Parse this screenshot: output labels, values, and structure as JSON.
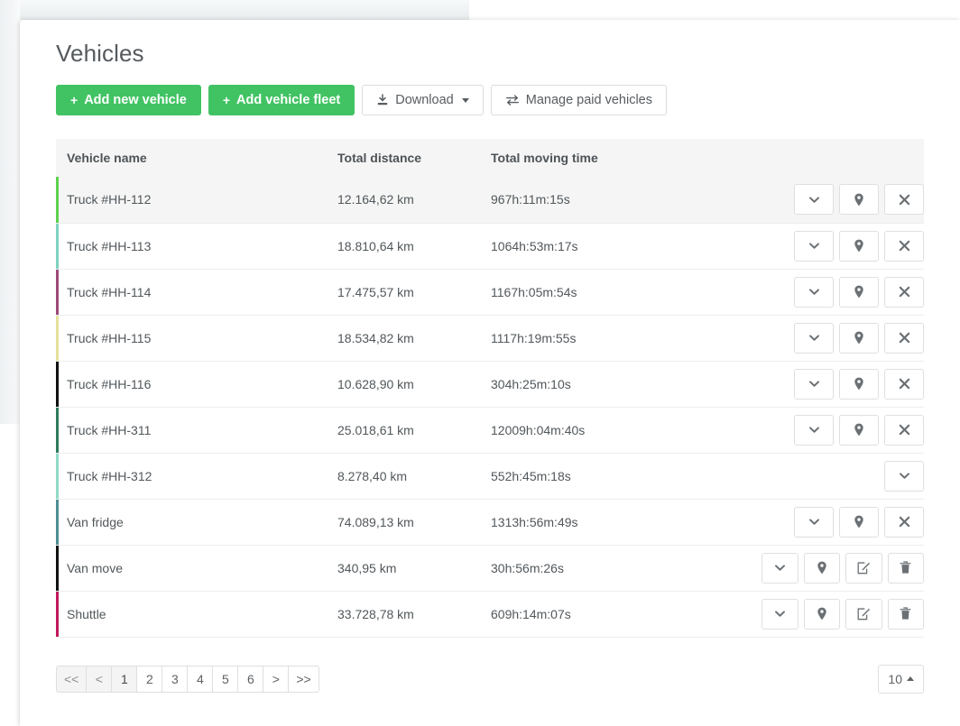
{
  "page": {
    "title": "Vehicles"
  },
  "toolbar": {
    "add_vehicle_label": "Add new vehicle",
    "add_fleet_label": "Add vehicle fleet",
    "download_label": "Download",
    "manage_paid_label": "Manage paid vehicles",
    "plus_glyph": "+",
    "accent_green": "#41c363"
  },
  "table": {
    "columns": [
      "Vehicle name",
      "Total distance",
      "Total moving time",
      ""
    ],
    "rows": [
      {
        "name": "Truck #HH-112",
        "distance": "12.164,62 km",
        "moving_time": "967h:11m:15s",
        "color": "#5ed14e",
        "striped": true,
        "actions": [
          "chevron-down-icon",
          "map-marker-icon",
          "close-icon"
        ]
      },
      {
        "name": "Truck #HH-113",
        "distance": "18.810,64 km",
        "moving_time": "1064h:53m:17s",
        "color": "#7fd3c0",
        "striped": false,
        "actions": [
          "chevron-down-icon",
          "map-marker-icon",
          "close-icon"
        ]
      },
      {
        "name": "Truck #HH-114",
        "distance": "17.475,57 km",
        "moving_time": "1167h:05m:54s",
        "color": "#b martinez",
        "striped": false,
        "actions": [
          "chevron-down-icon",
          "map-marker-icon",
          "close-icon"
        ]
      },
      {
        "name": "Truck #HH-115",
        "distance": "18.534,82 km",
        "moving_time": "1117h:19m:55s",
        "color": "#e5e09a",
        "striped": false,
        "actions": [
          "chevron-down-icon",
          "map-marker-icon",
          "close-icon"
        ]
      },
      {
        "name": "Truck #HH-116",
        "distance": "10.628,90 km",
        "moving_time": "304h:25m:10s",
        "color": "#111111",
        "striped": false,
        "actions": [
          "chevron-down-icon",
          "map-marker-icon",
          "close-icon"
        ]
      },
      {
        "name": "Truck #HH-311",
        "distance": "25.018,61 km",
        "moving_time": "12009h:04m:40s",
        "color": "#2f7b5c",
        "striped": false,
        "actions": [
          "chevron-down-icon",
          "map-marker-icon",
          "close-icon"
        ]
      },
      {
        "name": "Truck #HH-312",
        "distance": "8.278,40 km",
        "moving_time": "552h:45m:18s",
        "color": "#8fdcc5",
        "striped": false,
        "actions": [
          "chevron-down-icon"
        ]
      },
      {
        "name": "Van fridge",
        "distance": "74.089,13 km",
        "moving_time": "1313h:56m:49s",
        "color": "#4d8f93",
        "striped": false,
        "actions": [
          "chevron-down-icon",
          "map-marker-icon",
          "close-icon"
        ]
      },
      {
        "name": "Van move",
        "distance": "340,95 km",
        "moving_time": "30h:56m:26s",
        "color": "#111111",
        "striped": false,
        "actions": [
          "chevron-down-icon",
          "map-marker-icon",
          "edit-icon",
          "trash-icon"
        ]
      },
      {
        "name": "Shuttle",
        "distance": "33.728,78 km",
        "moving_time": "609h:14m:07s",
        "color": "#c2185b",
        "striped": false,
        "actions": [
          "chevron-down-icon",
          "map-marker-icon",
          "edit-icon",
          "trash-icon"
        ]
      }
    ]
  },
  "pagination": {
    "buttons": [
      {
        "label": "<<",
        "state": "muted"
      },
      {
        "label": "<",
        "state": "muted"
      },
      {
        "label": "1",
        "state": "active"
      },
      {
        "label": "2",
        "state": "normal"
      },
      {
        "label": "3",
        "state": "normal"
      },
      {
        "label": "4",
        "state": "normal"
      },
      {
        "label": "5",
        "state": "normal"
      },
      {
        "label": "6",
        "state": "normal"
      },
      {
        "label": ">",
        "state": "normal"
      },
      {
        "label": ">>",
        "state": "normal"
      }
    ],
    "page_size": "10"
  }
}
